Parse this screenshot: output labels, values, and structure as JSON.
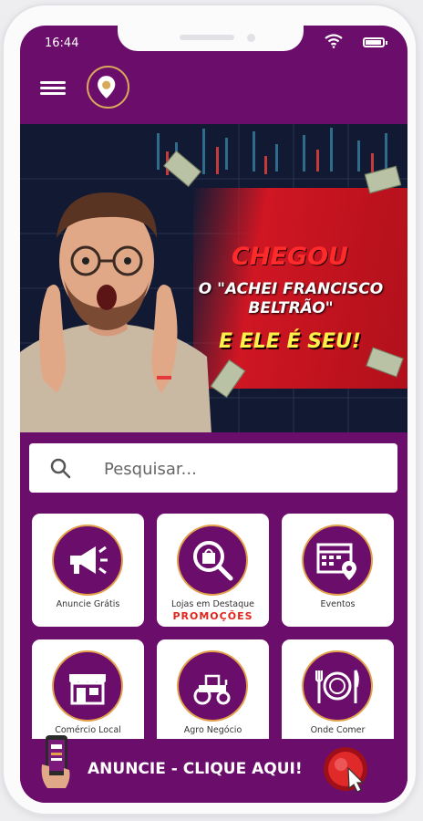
{
  "status": {
    "time": "16:44"
  },
  "icons": {
    "menu": "menu-icon",
    "logo": "location-pin-logo",
    "wifi": "wifi-icon",
    "battery": "battery-icon",
    "search": "search-icon"
  },
  "colors": {
    "brand_purple": "#6b0d6a",
    "accent_gold": "#e2a14a",
    "banner_red": "#d01623",
    "promo_red": "#e0261c"
  },
  "banner": {
    "line1": "CHEGOU",
    "line2": "O \"ACHEI FRANCISCO BELTRÃO\"",
    "line3": "E ELE É SEU!"
  },
  "search": {
    "placeholder": "Pesquisar..."
  },
  "tiles": [
    {
      "label": "Anuncie Grátis",
      "icon": "megaphone-icon"
    },
    {
      "label": "Lojas em Destaque",
      "sublabel": "PROMOÇÕES",
      "icon": "shopping-search-icon"
    },
    {
      "label": "Eventos",
      "icon": "calendar-location-icon"
    },
    {
      "label": "Comércio Local",
      "icon": "storefront-icon"
    },
    {
      "label": "Agro Negócio",
      "icon": "tractor-icon"
    },
    {
      "label": "Onde Comer",
      "icon": "plate-cutlery-icon"
    }
  ],
  "cta": {
    "label": "ANUNCIE - CLIQUE AQUI!",
    "icon": "click-hand-icon"
  }
}
